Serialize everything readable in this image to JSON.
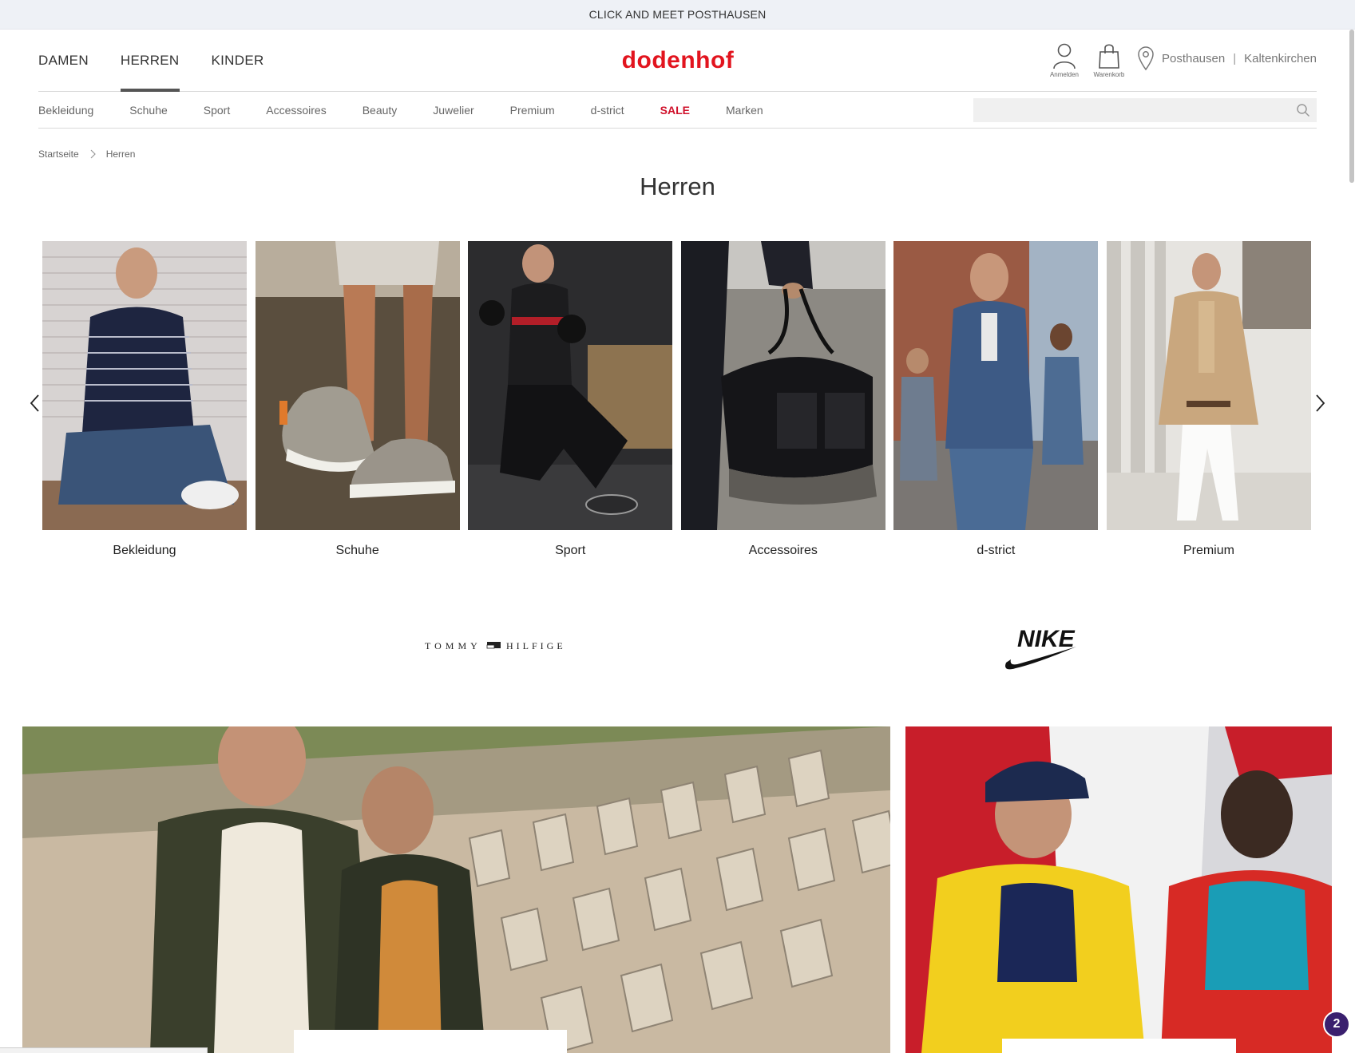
{
  "announcement": "CLICK AND MEET POSTHAUSEN",
  "gender_nav": [
    {
      "label": "DAMEN",
      "active": false
    },
    {
      "label": "HERREN",
      "active": true
    },
    {
      "label": "KINDER",
      "active": false
    }
  ],
  "logo_text": "dodenhof",
  "brand_color": "#e2141e",
  "header_icons": {
    "login": {
      "label": "Anmelden",
      "icon": "user-icon"
    },
    "cart": {
      "label": "Warenkorb",
      "icon": "shopping-bag-icon"
    }
  },
  "stores": {
    "icon": "location-pin-icon",
    "items": [
      "Posthausen",
      "Kaltenkirchen"
    ],
    "separator": "|"
  },
  "categories": [
    {
      "label": "Bekleidung"
    },
    {
      "label": "Schuhe"
    },
    {
      "label": "Sport"
    },
    {
      "label": "Accessoires"
    },
    {
      "label": "Beauty"
    },
    {
      "label": "Juwelier"
    },
    {
      "label": "Premium"
    },
    {
      "label": "d-strict"
    },
    {
      "label": "SALE",
      "highlight": true,
      "color": "#d0112b"
    },
    {
      "label": "Marken"
    }
  ],
  "search": {
    "placeholder": "",
    "icon": "search-icon"
  },
  "breadcrumb": [
    "Startseite",
    "Herren"
  ],
  "page_title": "Herren",
  "carousel": {
    "tiles": [
      {
        "label": "Bekleidung"
      },
      {
        "label": "Schuhe"
      },
      {
        "label": "Sport"
      },
      {
        "label": "Accessoires"
      },
      {
        "label": "d-strict"
      },
      {
        "label": "Premium"
      }
    ]
  },
  "brand_logos": {
    "tommy_text_left": "TOMMY",
    "tommy_text_right": "HILFIGER",
    "nike_text": "NIKE"
  },
  "chat_badge_count": "2"
}
